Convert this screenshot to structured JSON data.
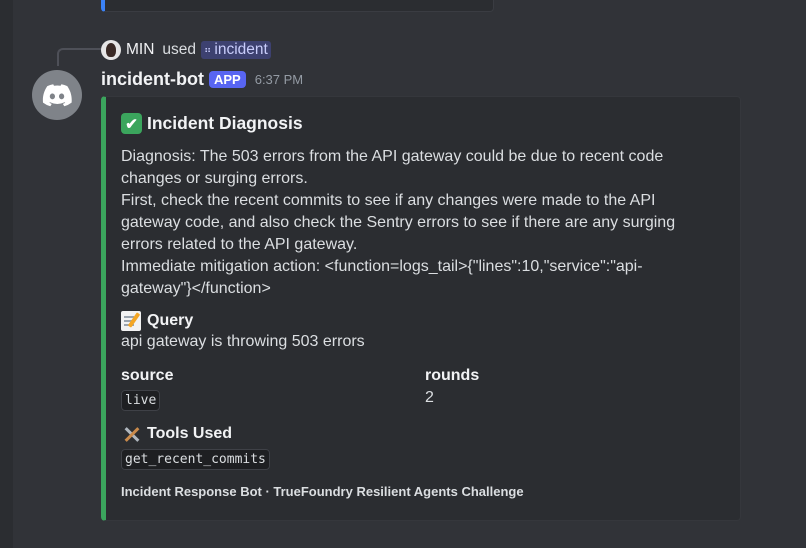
{
  "reply": {
    "user": "MIN",
    "used_text": "used",
    "command": "incident"
  },
  "message": {
    "username": "incident-bot",
    "badge": "APP",
    "timestamp": "6:37 PM"
  },
  "embed": {
    "accent_color": "#3ba55d",
    "title": "Incident Diagnosis",
    "title_icon": "check-mark-icon",
    "description_lines": [
      "Diagnosis: The 503 errors from the API gateway could be due to recent code changes or surging errors.",
      "First, check the recent commits to see if any changes were made to the API gateway code, and also check the Sentry errors to see if there are any surging errors related to the API gateway.",
      "Immediate mitigation action: <function=logs_tail>{\"lines\":10,\"service\":\"api-gateway\"}</function>"
    ],
    "query": {
      "icon": "memo-icon",
      "title": "Query",
      "value": "api gateway is throwing 503 errors"
    },
    "source": {
      "title": "source",
      "value": "live"
    },
    "rounds": {
      "title": "rounds",
      "value": "2"
    },
    "tools": {
      "icon": "tools-icon",
      "title": "Tools Used",
      "value": "get_recent_commits"
    },
    "footer": "Incident Response Bot · TrueFoundry Resilient Agents Challenge"
  }
}
